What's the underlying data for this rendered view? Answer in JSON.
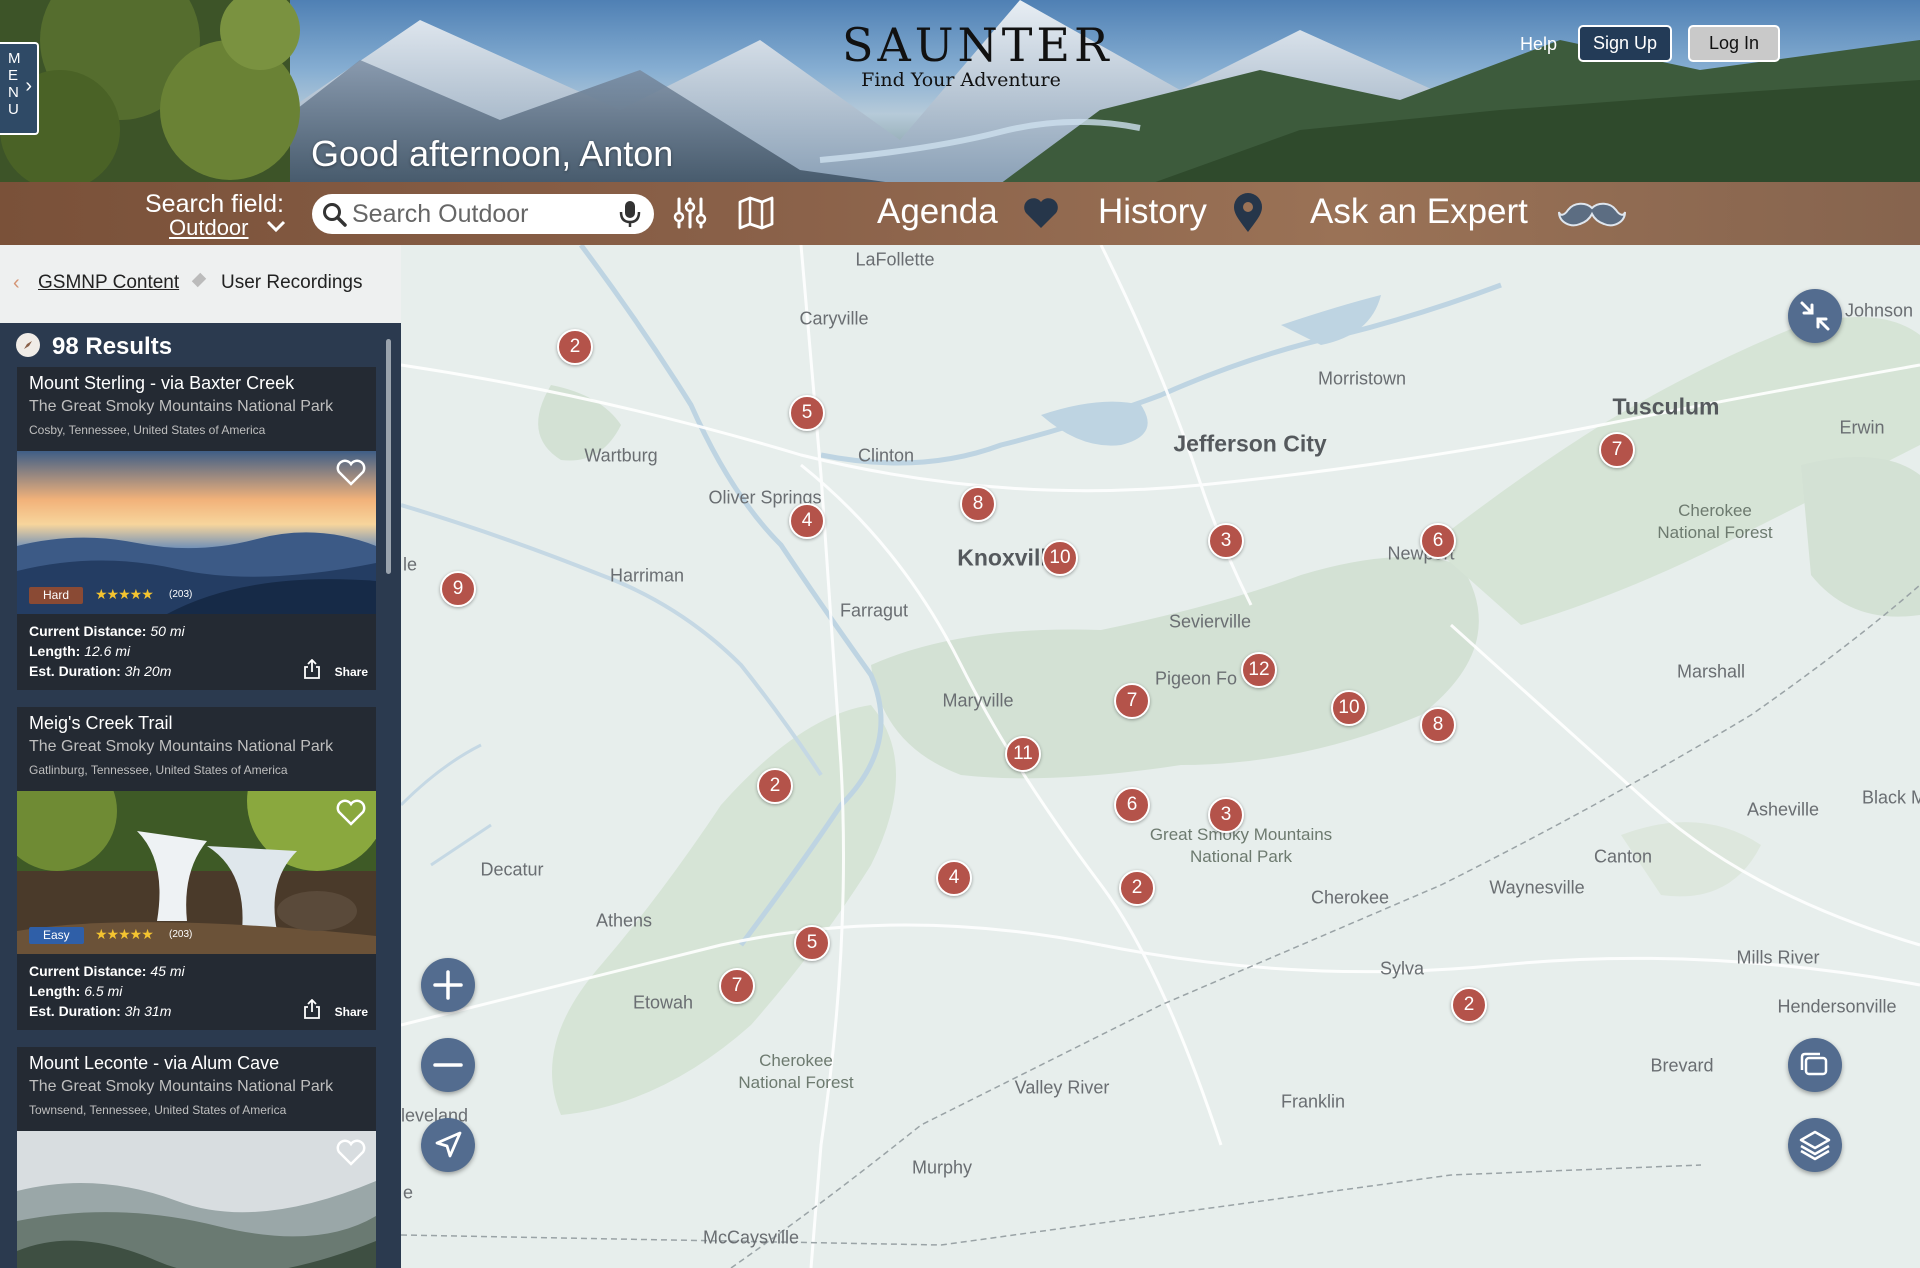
{
  "header": {
    "menu_label": "M E N U",
    "logo_name": "SAUNTER",
    "logo_tagline": "Find Your Adventure",
    "help": "Help",
    "sign_up": "Sign Up",
    "log_in": "Log In",
    "greeting": "Good afternoon, Anton"
  },
  "navbar": {
    "search_field_label": "Search field:",
    "search_field_value": "Outdoor",
    "search_placeholder": "Search Outdoor",
    "agenda": "Agenda",
    "history": "History",
    "ask_expert": "Ask an Expert"
  },
  "breadcrumb": {
    "parent": "GSMNP Content",
    "current": "User Recordings"
  },
  "sidebar": {
    "results_label": "98 Results",
    "cards": [
      {
        "title": "Mount Sterling - via Baxter Creek",
        "park": "The Great Smoky Mountains National Park",
        "location": "Cosby, Tennessee, United States of America",
        "difficulty": "Hard",
        "difficulty_color": "#8a4a34",
        "rating_stars": "★★★★★",
        "reviews": "(203)",
        "distance_label": "Current Distance:",
        "distance_value": "50 mi",
        "length_label": "Length:",
        "length_value": "12.6 mi",
        "duration_label": "Est. Duration:",
        "duration_value": "3h 20m",
        "share": "Share"
      },
      {
        "title": "Meig's Creek Trail",
        "park": "The Great Smoky Mountains National Park",
        "location": "Gatlinburg, Tennessee, United States of America",
        "difficulty": "Easy",
        "difficulty_color": "#2f5fa8",
        "rating_stars": "★★★★★",
        "reviews": "(203)",
        "distance_label": "Current Distance:",
        "distance_value": "45 mi",
        "length_label": "Length:",
        "length_value": "6.5 mi",
        "duration_label": "Est. Duration:",
        "duration_value": "3h 31m",
        "share": "Share"
      },
      {
        "title": "Mount Leconte - via Alum Cave",
        "park": "The Great Smoky Mountains National Park",
        "location": "Townsend, Tennessee, United States of America"
      }
    ]
  },
  "map": {
    "places": {
      "lafollette": "LaFollette",
      "caryville": "Caryville",
      "morristown": "Morristown",
      "tusculum": "Tusculum",
      "johnson": "Johnson",
      "erwin": "Erwin",
      "wartburg": "Wartburg",
      "clinton": "Clinton",
      "oliver_springs": "Oliver Springs",
      "jefferson_city": "Jefferson City",
      "harriman": "Harriman",
      "knoxville": "Knoxvill",
      "newport": "Newport",
      "farragut": "Farragut",
      "sevierville": "Sevierville",
      "pigeon_forge": "Pigeon Fo",
      "maryville": "Maryville",
      "marshall": "Marshall",
      "asheville": "Asheville",
      "black_m": "Black M",
      "canton": "Canton",
      "waynesville": "Waynesville",
      "cherokee": "Cherokee",
      "decatur": "Decatur",
      "athens": "Athens",
      "etowah": "Etowah",
      "sylva": "Sylva",
      "mills_river": "Mills River",
      "hendersonville": "Hendersonville",
      "brevard": "Brevard",
      "valley_river": "Valley River",
      "franklin": "Franklin",
      "cleveland": "Cleveland",
      "murphy": "Murphy",
      "mccaysville": "McCaysville",
      "le": "le",
      "e": "e",
      "gsmnp": "Great Smoky Mountains\nNational Park",
      "cherokee_nf_east": "Cherokee\nNational Forest",
      "cherokee_nf_south": "Cherokee\nNational Forest"
    },
    "markers": [
      "2",
      "5",
      "8",
      "4",
      "10",
      "3",
      "6",
      "7",
      "9",
      "12",
      "7",
      "10",
      "8",
      "11",
      "2",
      "6",
      "3",
      "2",
      "4",
      "5",
      "7",
      "2"
    ],
    "marker_color": "#b4534a",
    "control_color": "#536c8f"
  }
}
